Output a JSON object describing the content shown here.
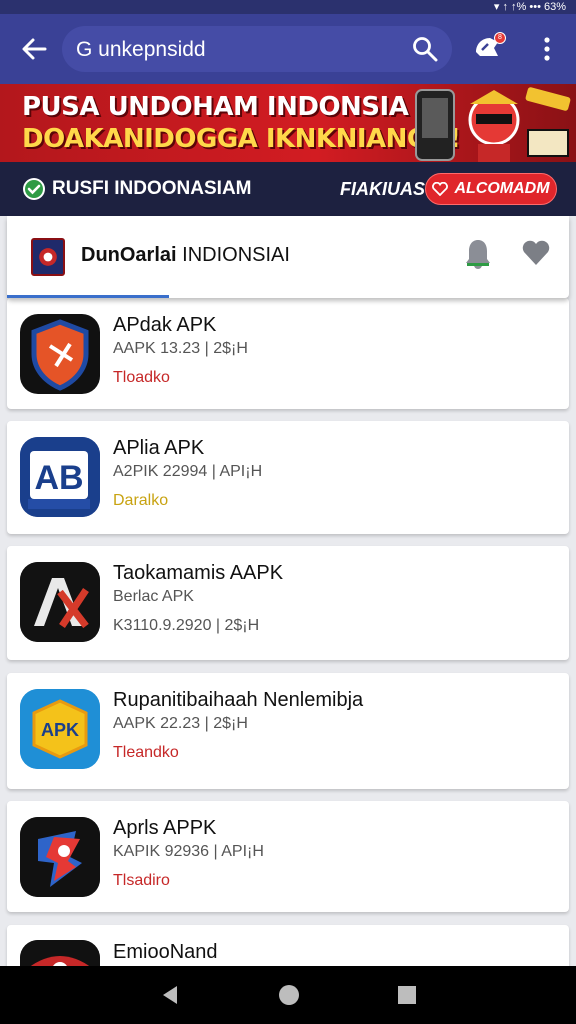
{
  "status_bar": {
    "right_text": "▾ ↑ ↑% ••• 63%"
  },
  "search": {
    "query": "G unkepnsidd"
  },
  "notifications": {
    "badge": "8"
  },
  "banner": {
    "line1": "PUSA UNDOHAM INDONSIA",
    "line2": "DOAKANIDOGGA IKNKNIANGN!"
  },
  "promo": {
    "left_text": "RUSFI INDOONASIAM",
    "mid_text": "FIAKIUAS",
    "button_label": "ALCOMADM"
  },
  "header": {
    "title_bold": "DunOarlai",
    "title_rest": "INDIONSIAI"
  },
  "apps": [
    {
      "name": "APdak APK",
      "meta": "AAPK 13.23 | 2$¡H",
      "status": "Tloadko",
      "status_color": "#c62828",
      "icon": "shield-app-icon"
    },
    {
      "name": "APlia APK",
      "meta": "A2PIK 22994 | API¡H",
      "status": "Daralko",
      "status_color": "#c8a312",
      "icon": "ab-app-icon"
    },
    {
      "name": "Taokamamis AAPK",
      "meta": "Berlac APK",
      "meta2": "K3110.9.2920 | 2$¡H",
      "status": "",
      "status_color": "#c62828",
      "icon": "ax-app-icon"
    },
    {
      "name": "Rupanitibaihaah Nenlemibja",
      "meta": "AAPK 22.23 | 2$¡H",
      "status": "Tleandko",
      "status_color": "#c62828",
      "icon": "apk-badge-app-icon"
    },
    {
      "name": "Aprls APPK",
      "meta": "KAPIK 92936 | API¡H",
      "status": "Tlsadiro",
      "status_color": "#c62828",
      "icon": "fighter-app-icon"
    },
    {
      "name": "EmiooNand",
      "meta": "",
      "status": "",
      "status_color": "#c62828",
      "icon": "red-app-icon"
    }
  ]
}
